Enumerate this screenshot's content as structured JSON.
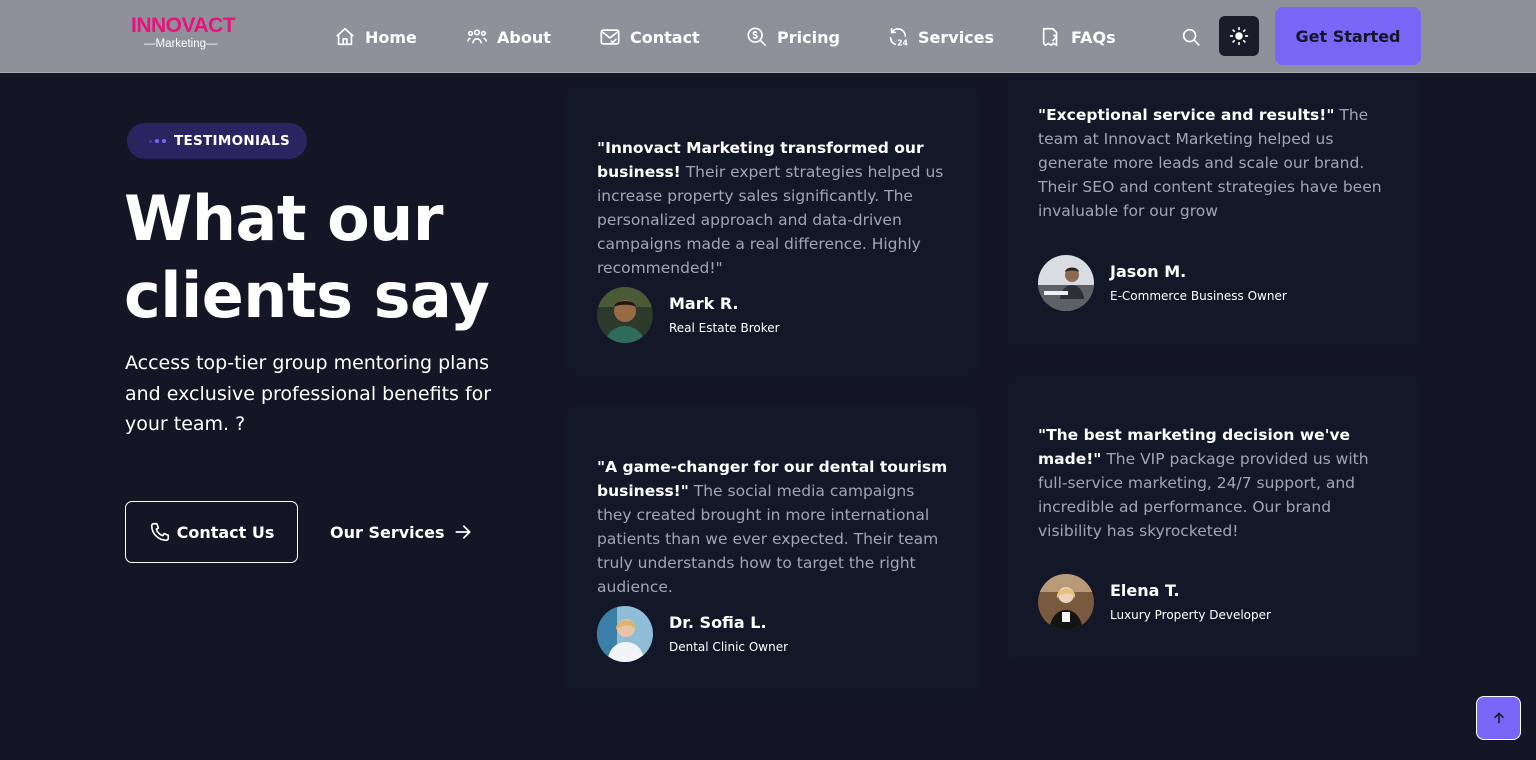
{
  "brand": {
    "name": "INNOVACT",
    "tagline": "—Marketing—",
    "accent": "#e8127c"
  },
  "nav": {
    "items": [
      {
        "label": "Home",
        "icon": "home-icon"
      },
      {
        "label": "About",
        "icon": "users-icon"
      },
      {
        "label": "Contact",
        "icon": "mail-icon"
      },
      {
        "label": "Pricing",
        "icon": "pricing-icon"
      },
      {
        "label": "Services",
        "icon": "24h-services-icon"
      },
      {
        "label": "FAQs",
        "icon": "faq-icon"
      }
    ],
    "cta_label": "Get Started"
  },
  "hero": {
    "badge": "TESTIMONIALS",
    "headline_line1": "What our",
    "headline_line2": "clients say",
    "subtext": "Access top-tier group mentoring plans and exclusive professional benefits for your team. ?",
    "contact_label": "Contact Us",
    "services_label": "Our Services"
  },
  "testimonials": [
    {
      "headline": "\"Innovact Marketing transformed our business!",
      "body": "Their expert strategies helped us increase property sales significantly. The personalized approach and data-driven campaigns made a real difference. Highly recommended!\"",
      "name": "Mark R.",
      "role": "Real Estate Broker"
    },
    {
      "headline": "\"Exceptional service and results!\"",
      "body": "The team at Innovact Marketing helped us generate more leads and scale our brand. Their SEO and content strategies have been invaluable for our grow",
      "name": "Jason M.",
      "role": "E-Commerce Business Owner"
    },
    {
      "headline": "\"A game-changer for our dental tourism business!\"",
      "body": "The social media campaigns they created brought in more international patients than we ever expected. Their team truly understands how to target the right audience.",
      "name": "Dr. Sofia L.",
      "role": "Dental Clinic Owner"
    },
    {
      "headline": "\"The best marketing decision we've made!\"",
      "body": "The VIP package provided us with full-service marketing, 24/7 support, and incredible ad performance. Our brand visibility has skyrocketed!",
      "name": "Elena T.",
      "role": "Luxury Property Developer"
    }
  ],
  "colors": {
    "background": "#151625",
    "header": "#8f9099",
    "primary": "#7b65f6",
    "card": "#121827"
  }
}
